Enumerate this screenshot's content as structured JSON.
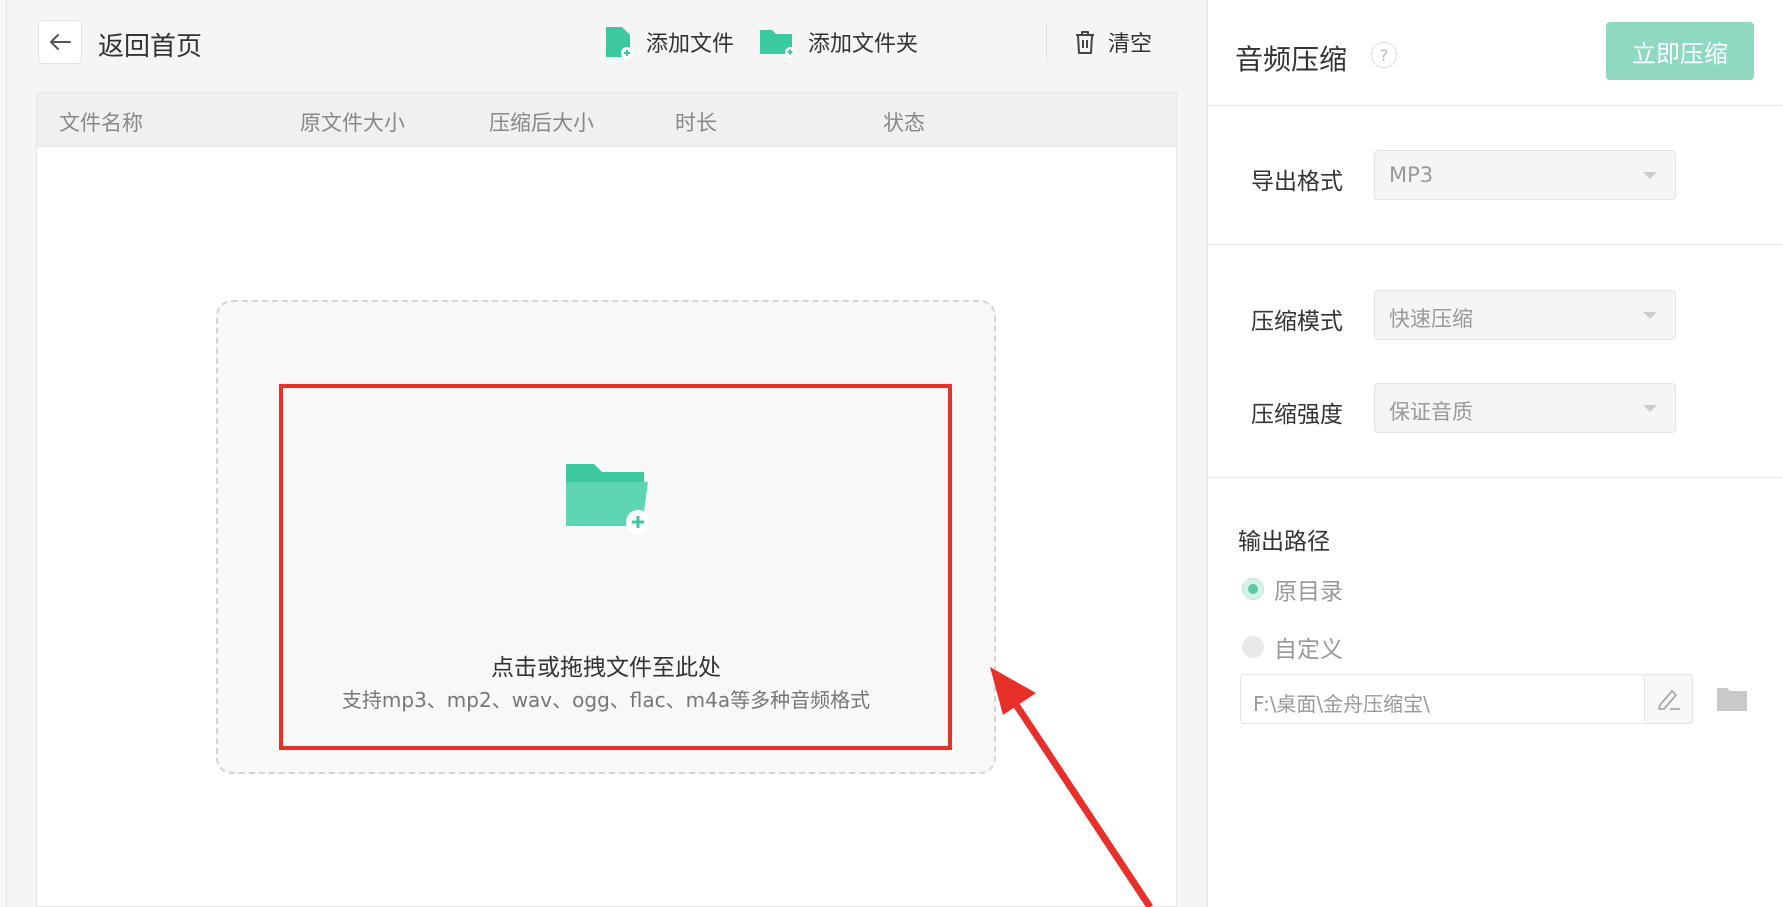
{
  "header": {
    "back_label": "返回首页",
    "add_file_label": "添加文件",
    "add_folder_label": "添加文件夹",
    "clear_label": "清空"
  },
  "table": {
    "columns": [
      "文件名称",
      "原文件大小",
      "压缩后大小",
      "时长",
      "状态"
    ]
  },
  "dropzone": {
    "title": "点击或拖拽文件至此处",
    "subtitle": "支持mp3、mp2、wav、ogg、flac、m4a等多种音频格式"
  },
  "settings": {
    "title": "音频压缩",
    "help_icon": "?",
    "compress_button": "立即压缩",
    "format_label": "导出格式",
    "format_value": "MP3",
    "mode_label": "压缩模式",
    "mode_value": "快速压缩",
    "strength_label": "压缩强度",
    "strength_value": "保证音质",
    "output_label": "输出路径",
    "option_original": "原目录",
    "option_custom": "自定义",
    "output_path": "F:\\桌面\\金舟压缩宝\\"
  },
  "colors": {
    "accent": "#3cc9a0",
    "accent_disabled": "#8fd8c2",
    "highlight": "#e8302a"
  },
  "icons": [
    "back-arrow-icon",
    "add-file-icon",
    "add-folder-icon",
    "trash-icon",
    "folder-plus-icon",
    "help-icon",
    "dropdown-arrow-icon",
    "edit-pen-icon",
    "folder-icon"
  ]
}
